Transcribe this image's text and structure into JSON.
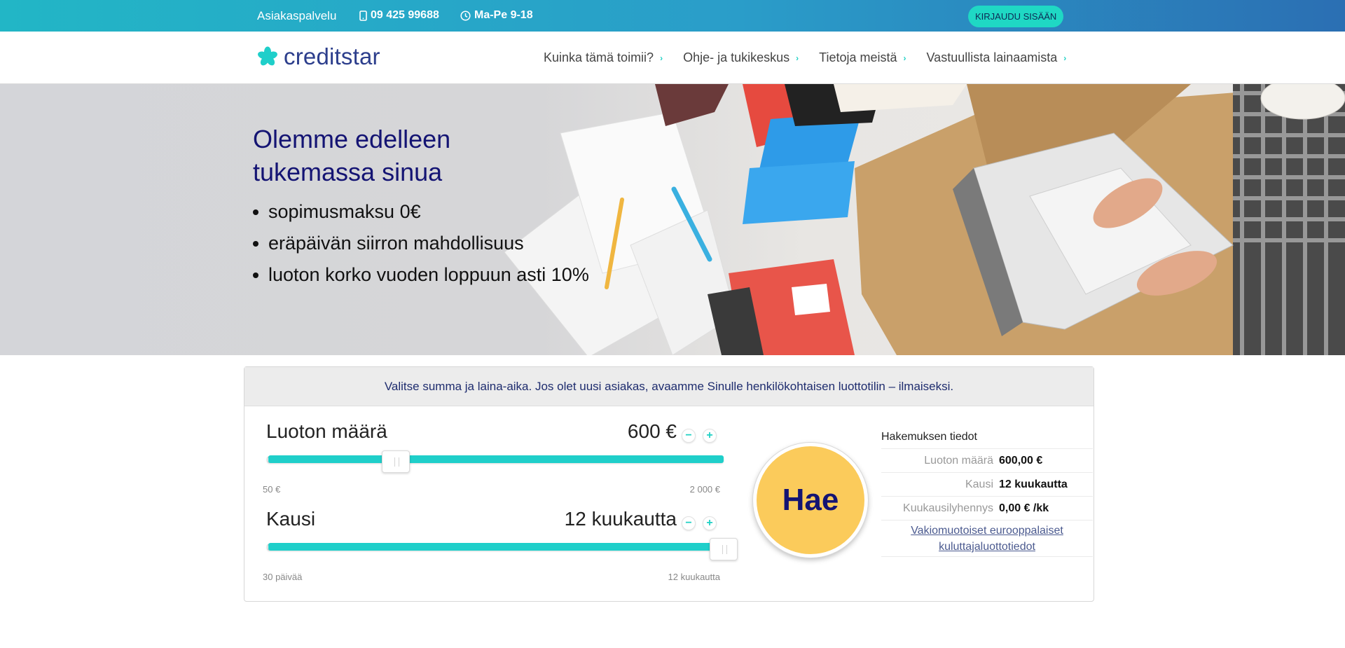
{
  "topbar": {
    "service_label": "Asiakaspalvelu",
    "phone": "09 425 99688",
    "hours": "Ma-Pe 9-18",
    "login_label": "KIRJAUDU SISÄÄN"
  },
  "brand": {
    "name": "creditstar"
  },
  "nav": {
    "items": [
      {
        "label": "Kuinka tämä toimii?"
      },
      {
        "label": "Ohje- ja tukikeskus"
      },
      {
        "label": "Tietoja meistä"
      },
      {
        "label": "Vastuullista lainaamista"
      }
    ]
  },
  "hero": {
    "title": "Olemme edelleen tukemassa sinua",
    "bullets": [
      "sopimusmaksu 0€",
      "eräpäivän siirron mahdollisuus",
      "luoton korko vuoden loppuun asti 10%"
    ]
  },
  "calculator": {
    "intro": "Valitse summa ja laina-aika. Jos olet uusi asiakas, avaamme Sinulle henkilökohtaisen luottotilin – ilmaiseksi.",
    "amount": {
      "label": "Luoton määrä",
      "value": "600 €",
      "min_label": "50 €",
      "max_label": "2 000 €",
      "fill_fraction": 0.28
    },
    "period": {
      "label": "Kausi",
      "value": "12 kuukautta",
      "min_label": "30 päivää",
      "max_label": "12 kuukautta",
      "fill_fraction": 1.0
    },
    "minus": "−",
    "plus": "+",
    "apply_label": "Hae"
  },
  "summary": {
    "title": "Hakemuksen tiedot",
    "rows": [
      {
        "key": "Luoton määrä",
        "value": "600,00 €"
      },
      {
        "key": "Kausi",
        "value": "12 kuukautta"
      },
      {
        "key": "Kuukausilyhennys",
        "value": "0,00 € /kk"
      }
    ],
    "link": "Vakiomuotoiset eurooppalaiset kuluttajaluottotiedot"
  },
  "colors": {
    "accent": "#1fcfca",
    "brand_navy": "#141473",
    "apply_button": "#fbcb5b"
  }
}
